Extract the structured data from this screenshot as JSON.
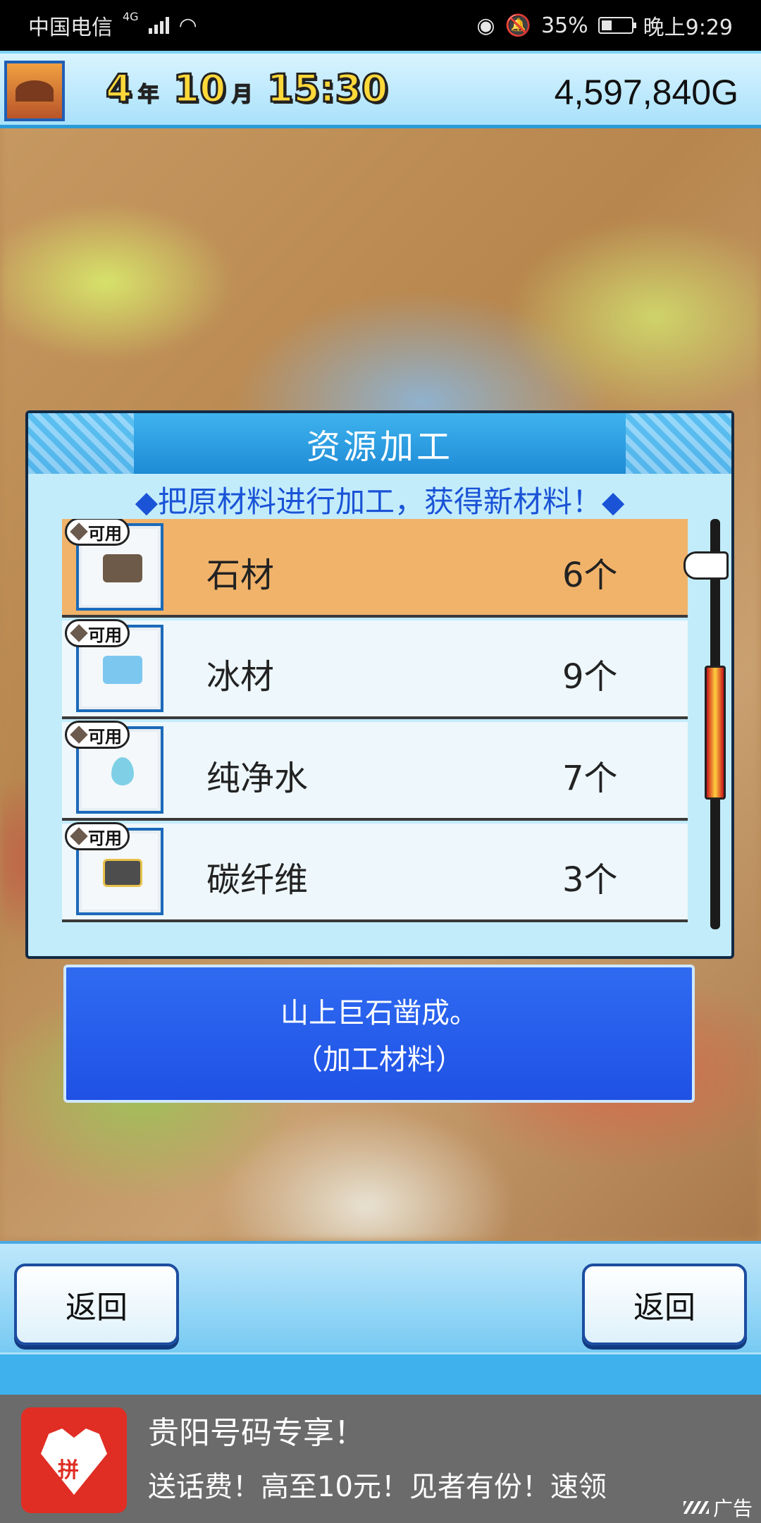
{
  "status_bar": {
    "carrier": "中国电信",
    "network": "4G",
    "battery": "35%",
    "time": "晚上9:29"
  },
  "header": {
    "year_num": "4",
    "year_unit": "年",
    "month_num": "10",
    "month_unit": "月",
    "clock": "15:30",
    "money": "4,597,840G"
  },
  "dialog": {
    "title": "资源加工",
    "subtitle": "◆把原材料进行加工，获得新材料！◆",
    "items": [
      {
        "name": "石材",
        "count": "6个",
        "badge": "可用",
        "icon": "stone-icon",
        "color": "#6e5a48"
      },
      {
        "name": "冰材",
        "count": "9个",
        "badge": "可用",
        "icon": "ice-icon",
        "color": "#7cc7f0"
      },
      {
        "name": "纯净水",
        "count": "7个",
        "badge": "可用",
        "icon": "water-drop-icon",
        "color": "#7fd0e6"
      },
      {
        "name": "碳纤维",
        "count": "3个",
        "badge": "可用",
        "icon": "carbon-fiber-icon",
        "color": "#4d4d4d"
      }
    ],
    "selected_index": 0
  },
  "description": {
    "line1": "山上巨石凿成。",
    "line2": "（加工材料）"
  },
  "bottom": {
    "back_left": "返回",
    "back_right": "返回"
  },
  "ad": {
    "logo_text": "拼",
    "title": "贵阳号码专享！",
    "text": "送话费！高至10元！见者有份！速领",
    "label": "广告"
  },
  "colors": {
    "selected_row": "#f1b36a",
    "title_bar": "#1e8bd6",
    "subtitle": "#1a53d6",
    "desc_box": "#1f51e5"
  }
}
